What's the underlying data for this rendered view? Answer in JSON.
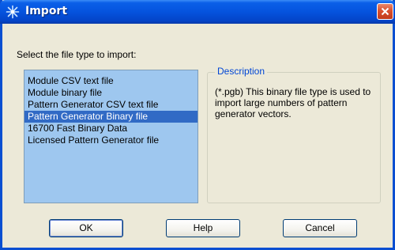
{
  "window": {
    "title": "Import",
    "icon": "import-app-icon",
    "close_icon": "close-icon"
  },
  "prompt": "Select the file type to import:",
  "file_types": {
    "items": [
      "Module CSV text file",
      "Module binary file",
      "Pattern Generator CSV text file",
      "Pattern Generator Binary file",
      "16700 Fast Binary Data",
      "Licensed Pattern Generator file"
    ],
    "selected": "Pattern Generator Binary file"
  },
  "description": {
    "heading": "Description",
    "text": "(*.pgb) This binary file type is used to import large numbers of pattern generator vectors."
  },
  "buttons": {
    "ok": "OK",
    "help": "Help",
    "cancel": "Cancel"
  },
  "colors": {
    "title_bar": "#0553de",
    "list_background": "#9ec7ef",
    "selection": "#316ac5",
    "group_heading": "#0046d5",
    "dialog_face": "#ece9d8"
  }
}
